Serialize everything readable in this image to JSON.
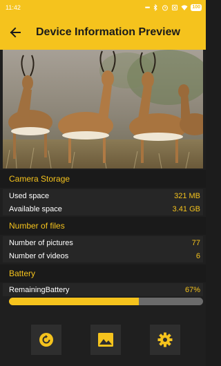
{
  "status_bar": {
    "time": "11:42",
    "battery": "100",
    "indicators": [
      "more-dots-icon",
      "bluetooth-icon",
      "alarm-icon",
      "sim-off-icon",
      "wifi-icon"
    ]
  },
  "header": {
    "title": "Device Information Preview",
    "back_icon": "arrow-left-icon"
  },
  "preview_image": "impala-herd-photo",
  "camera_storage": {
    "heading": "Camera Storage",
    "used_label": "Used space",
    "used_value": "321 MB",
    "available_label": "Available space",
    "available_value": "3.41 GB"
  },
  "files": {
    "heading": "Number of files",
    "pictures_label": "Number of pictures",
    "pictures_value": "77",
    "videos_label": "Number of videos",
    "videos_value": "6"
  },
  "battery": {
    "heading": "Battery",
    "label": "RemainingBattery",
    "value": "67%",
    "level": 0.67
  },
  "actions": [
    {
      "icon": "refresh-icon"
    },
    {
      "icon": "gallery-icon"
    },
    {
      "icon": "settings-icon"
    }
  ],
  "colors": {
    "accent": "#f5c31d",
    "background": "#1f1f1f",
    "row_background": "#262626",
    "battery_track": "#6b6b6b"
  }
}
